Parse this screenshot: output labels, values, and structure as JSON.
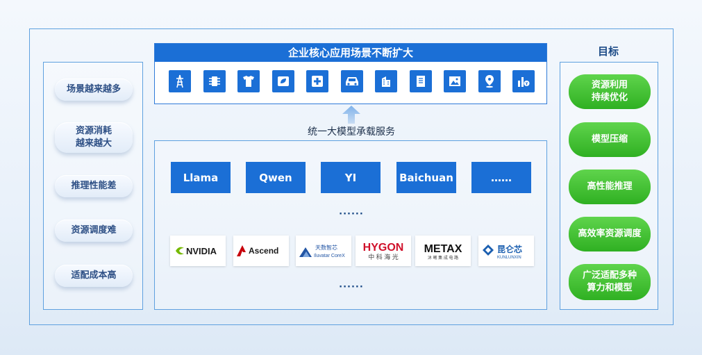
{
  "top": {
    "title": "企业核心应用场景不断扩大",
    "icons": [
      "power-tower-icon",
      "circuit-icon",
      "tshirt-icon",
      "eco-box-icon",
      "medical-cross-icon",
      "car-icon",
      "building-icon",
      "document-icon",
      "image-icon",
      "location-pin-icon",
      "finance-chart-icon"
    ]
  },
  "middle": {
    "label": "统一大模型承载服务",
    "models": [
      "Llama",
      "Qwen",
      "YI",
      "Baichuan",
      "……"
    ],
    "dots_mid": "······",
    "dots_bottom": "······",
    "vendors": [
      {
        "name": "NVIDIA",
        "color": "#76b900"
      },
      {
        "name": "Ascend",
        "color": "#c7000b"
      },
      {
        "name": "天数智芯",
        "sub": "Iluvatar CoreX",
        "color": "#2255a4"
      },
      {
        "name": "HYGON",
        "sub": "中 科 海 光",
        "color": "#d0112b"
      },
      {
        "name": "METAX",
        "sub": "沐 曦 集 成 电 路",
        "color": "#111111"
      },
      {
        "name": "昆仑芯",
        "sub": "KUNLUNXIN",
        "color": "#1b5fb0"
      }
    ]
  },
  "left": {
    "items": [
      [
        "场景越来越多"
      ],
      [
        "资源消耗",
        "越来越大"
      ],
      [
        "推理性能差"
      ],
      [
        "资源调度难"
      ],
      [
        "适配成本高"
      ]
    ]
  },
  "right": {
    "title": "目标",
    "items": [
      [
        "资源利用",
        "持续优化"
      ],
      [
        "模型压缩"
      ],
      [
        "高性能推理"
      ],
      [
        "高效率资源调度"
      ],
      [
        "广泛适配多种",
        "算力和模型"
      ]
    ]
  }
}
